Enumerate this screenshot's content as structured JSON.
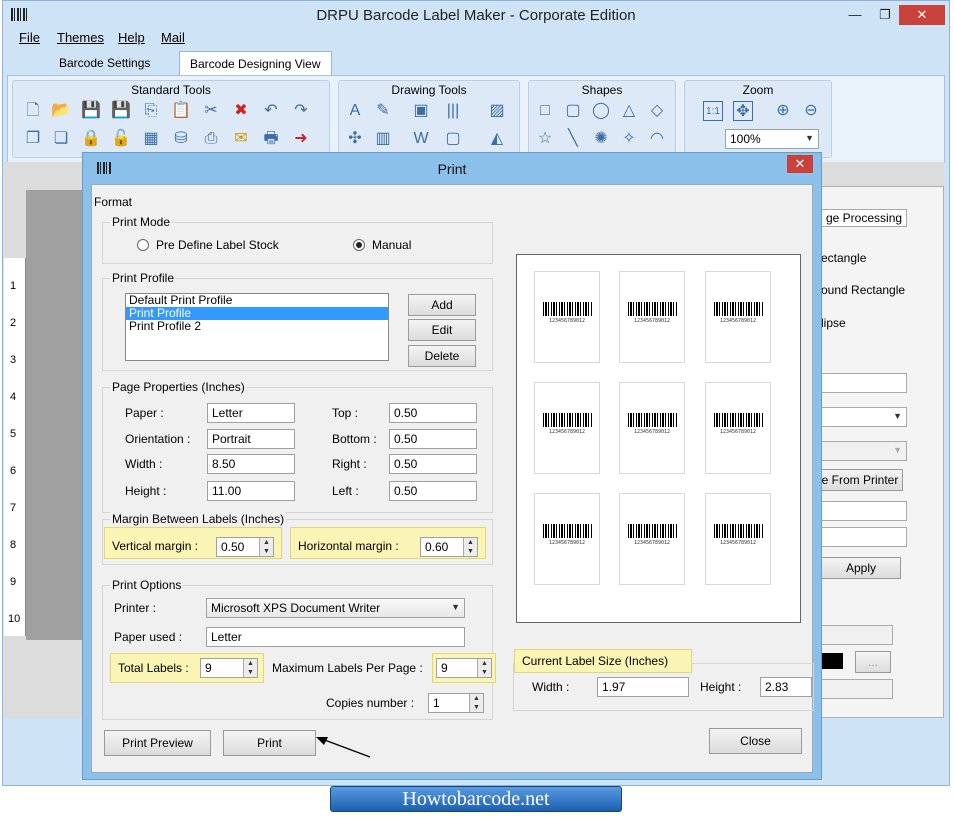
{
  "window": {
    "title": "DRPU Barcode Label Maker - Corporate Edition",
    "controls": {
      "minimize": "—",
      "restore": "❐",
      "close": "✕"
    }
  },
  "menu": [
    "File",
    "Themes",
    "Help",
    "Mail"
  ],
  "tabs": [
    "Barcode Settings",
    "Barcode Designing View"
  ],
  "ribbon": {
    "groups": [
      "Standard Tools",
      "Drawing Tools",
      "Shapes",
      "Zoom"
    ],
    "zoom_value": "100%"
  },
  "ruler": [
    "1",
    "2",
    "3",
    "4",
    "5",
    "6",
    "7",
    "8",
    "9",
    "10"
  ],
  "right_panel": {
    "tab": "ge Processing",
    "items": [
      "ectangle",
      "ound Rectangle",
      "lipse"
    ],
    "from_printer": "e From Printer",
    "apply": "Apply",
    "more": "..."
  },
  "dialog": {
    "title": "Print",
    "close": "✕",
    "format_label": "Format",
    "print_mode": {
      "title": "Print Mode",
      "options": [
        "Pre Define Label Stock",
        "Manual"
      ],
      "selected": "Manual"
    },
    "print_profile": {
      "title": "Print Profile",
      "items": [
        "Default Print Profile",
        "Print Profile",
        "Print Profile 2"
      ],
      "selected_index": 1,
      "buttons": {
        "add": "Add",
        "edit": "Edit",
        "delete": "Delete"
      }
    },
    "page_properties": {
      "title": "Page Properties (Inches)",
      "paper_label": "Paper :",
      "paper": "Letter",
      "orientation_label": "Orientation :",
      "orientation": "Portrait",
      "width_label": "Width :",
      "width": "8.50",
      "height_label": "Height :",
      "height": "11.00",
      "top_label": "Top :",
      "top": "0.50",
      "bottom_label": "Bottom :",
      "bottom": "0.50",
      "right_label": "Right :",
      "right": "0.50",
      "left_label": "Left :",
      "left": "0.50"
    },
    "margin": {
      "title": "Margin Between Labels (Inches)",
      "vertical_label": "Vertical margin :",
      "vertical": "0.50",
      "horizontal_label": "Horizontal margin :",
      "horizontal": "0.60"
    },
    "print_options": {
      "title": "Print Options",
      "printer_label": "Printer :",
      "printer": "Microsoft XPS Document Writer",
      "paper_used_label": "Paper used :",
      "paper_used": "Letter",
      "total_labels_label": "Total Labels :",
      "total_labels": "9",
      "max_labels_label": "Maximum Labels Per Page :",
      "max_labels": "9",
      "copies_label": "Copies number :",
      "copies": "1"
    },
    "label_size": {
      "title": "Current Label Size (Inches)",
      "width_label": "Width :",
      "width": "1.97",
      "height_label": "Height :",
      "height": "2.83"
    },
    "preview_barcode_text": "123456789012",
    "buttons": {
      "preview": "Print Preview",
      "print": "Print",
      "close": "Close"
    }
  },
  "banner": "Howtobarcode.net",
  "colors": {
    "title_bg": "#cfe3f7",
    "dialog_frame": "#8bc0ea",
    "highlight": "#fbf5b5",
    "selection": "#3399ff"
  }
}
